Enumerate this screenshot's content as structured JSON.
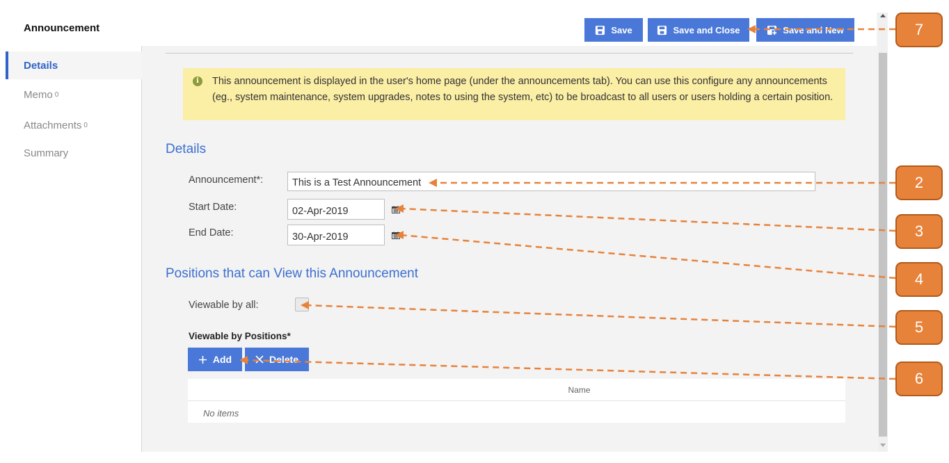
{
  "window": {
    "title": "Announcement"
  },
  "toolbar": {
    "save_label": "Save",
    "save_close_label": "Save and Close",
    "save_new_label": "Save and New"
  },
  "sidebar": {
    "items": [
      {
        "label": "Details",
        "count": ""
      },
      {
        "label": "Memo",
        "count": "0"
      },
      {
        "label": "Attachments",
        "count": "0"
      },
      {
        "label": "Summary",
        "count": ""
      }
    ]
  },
  "info": {
    "text": "This announcement is displayed in the user's home page (under the announcements tab). You can use this configure any announcements (eg., system maintenance, system upgrades, notes to using the system, etc) to be broadcast to all users or users holding a certain position."
  },
  "details": {
    "heading": "Details",
    "announcement_label": "Announcement*:",
    "announcement_value": "This is a Test Announcement",
    "start_label": "Start Date:",
    "start_value": "02-Apr-2019",
    "end_label": "End Date:",
    "end_value": "30-Apr-2019"
  },
  "positions": {
    "heading": "Positions that can View this Announcement",
    "viewable_all_label": "Viewable by all:",
    "viewable_all_checked": false,
    "viewable_positions_label": "Viewable by Positions*",
    "add_label": "Add",
    "delete_label": "Delete",
    "grid_header": "Name",
    "grid_empty": "No items"
  },
  "icons": {
    "save": "save-icon",
    "save_new": "save-new-icon",
    "info": "info-icon",
    "calendar": "calendar-icon",
    "add": "plus-icon",
    "delete": "x-icon"
  },
  "colors": {
    "accent": "#4a78d8",
    "heading": "#3b6fd1",
    "info_bg": "#fbeea5",
    "callout": "#e7823a"
  },
  "callouts": [
    "7",
    "2",
    "3",
    "4",
    "5",
    "6"
  ]
}
